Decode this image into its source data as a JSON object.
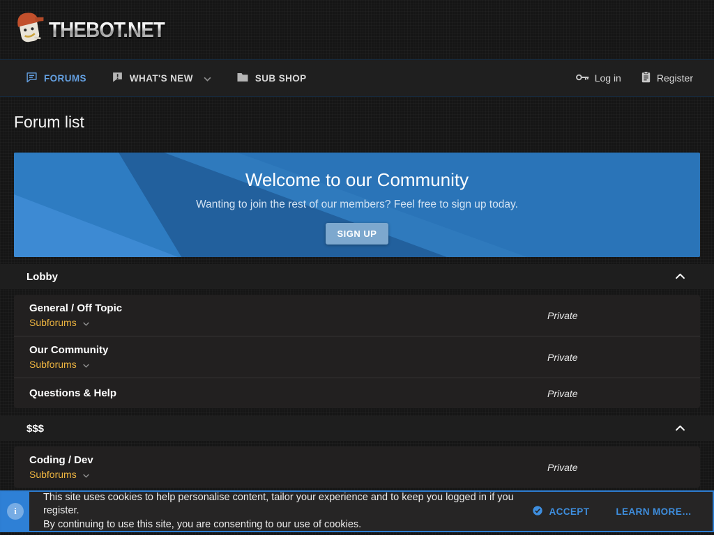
{
  "site": {
    "name": "THEBOT.NET"
  },
  "nav": {
    "items": [
      {
        "label": "FORUMS",
        "active": true
      },
      {
        "label": "WHAT'S NEW",
        "active": false,
        "has_dropdown": true
      },
      {
        "label": "SUB SHOP",
        "active": false
      }
    ],
    "login_label": "Log in",
    "register_label": "Register"
  },
  "page": {
    "title": "Forum list"
  },
  "banner": {
    "title": "Welcome to our Community",
    "subtitle": "Wanting to join the rest of our members? Feel free to sign up today.",
    "cta_label": "SIGN UP"
  },
  "sections": [
    {
      "title": "Lobby",
      "collapsed": false,
      "forums": [
        {
          "name": "General / Off Topic",
          "subforums_label": "Subforums",
          "status": "Private"
        },
        {
          "name": "Our Community",
          "subforums_label": "Subforums",
          "status": "Private"
        },
        {
          "name": "Questions & Help",
          "subforums_label": null,
          "status": "Private"
        }
      ]
    },
    {
      "title": "$$$",
      "collapsed": false,
      "forums": [
        {
          "name": "Coding / Dev",
          "subforums_label": "Subforums",
          "status": "Private"
        }
      ]
    }
  ],
  "cookie_notice": {
    "line1": "This site uses cookies to help personalise content, tailor your experience and to keep you logged in if you register.",
    "line2": "By continuing to use this site, you are consenting to our use of cookies.",
    "accept_label": "ACCEPT",
    "learn_more_label": "LEARN MORE…"
  },
  "icons": {
    "forums": "chat-bubble",
    "whats_new": "alert-bubble",
    "sub_shop": "folder",
    "login": "key",
    "register": "clipboard",
    "section_collapse": "chevron-up",
    "subforums_toggle": "chevron-down",
    "cookie_info": "info-circle",
    "accept": "check-circle"
  },
  "colors": {
    "accent_blue": "#2e80d6",
    "banner_blue": "#2a74b8",
    "link_yellow": "#edb440",
    "nav_active_blue": "#64a0e1",
    "signup_button": "#7da8ce"
  }
}
